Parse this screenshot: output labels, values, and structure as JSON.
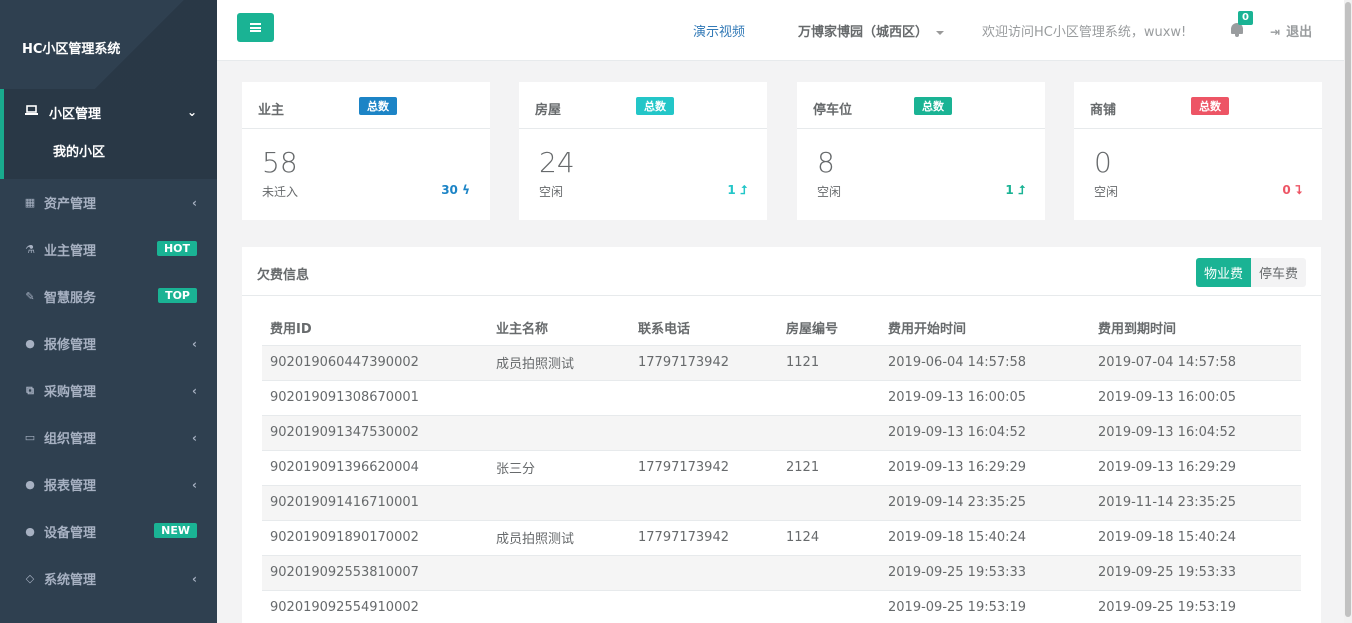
{
  "sidebar": {
    "brand": "HC小区管理系统",
    "active": {
      "label": "小区管理",
      "sub": "我的小区"
    },
    "items": [
      {
        "label": "资产管理",
        "icon": "grid-icon",
        "badge": ""
      },
      {
        "label": "业主管理",
        "icon": "flask-icon",
        "badge": "HOT"
      },
      {
        "label": "智慧服务",
        "icon": "edit-icon",
        "badge": "TOP"
      },
      {
        "label": "报修管理",
        "icon": "globe-icon",
        "badge": ""
      },
      {
        "label": "采购管理",
        "icon": "copy-icon",
        "badge": ""
      },
      {
        "label": "组织管理",
        "icon": "desktop-icon",
        "badge": ""
      },
      {
        "label": "报表管理",
        "icon": "globe-icon",
        "badge": ""
      },
      {
        "label": "设备管理",
        "icon": "globe-icon",
        "badge": "NEW"
      },
      {
        "label": "系统管理",
        "icon": "diamond-icon",
        "badge": ""
      }
    ]
  },
  "topbar": {
    "demo": "演示视频",
    "community": "万博家博园（城西区）",
    "welcome": "欢迎访问HC小区管理系统，wuxw!",
    "notifications": "0",
    "logout": "退出"
  },
  "cards": [
    {
      "title": "业主",
      "label": "总数",
      "label_color": "#1c84c6",
      "value": "58",
      "sub": "未迁入",
      "stat": "30",
      "stat_icon": "ϟ",
      "stat_color": "#1c84c6"
    },
    {
      "title": "房屋",
      "label": "总数",
      "label_color": "#23c6c8",
      "value": "24",
      "sub": "空闲",
      "stat": "1",
      "stat_icon": "⮥",
      "stat_color": "#23c6c8"
    },
    {
      "title": "停车位",
      "label": "总数",
      "label_color": "#1ab394",
      "value": "8",
      "sub": "空闲",
      "stat": "1",
      "stat_icon": "⮥",
      "stat_color": "#1ab394"
    },
    {
      "title": "商铺",
      "label": "总数",
      "label_color": "#ed5565",
      "value": "0",
      "sub": "空闲",
      "stat": "0",
      "stat_icon": "⮧",
      "stat_color": "#ed5565"
    }
  ],
  "fees": {
    "title": "欠费信息",
    "tab_active": "物业费",
    "tab_other": "停车费",
    "columns": [
      "费用ID",
      "业主名称",
      "联系电话",
      "房屋编号",
      "费用开始时间",
      "费用到期时间"
    ],
    "rows": [
      [
        "902019060447390002",
        "成员拍照测试",
        "17797173942",
        "1121",
        "2019-06-04 14:57:58",
        "2019-07-04 14:57:58"
      ],
      [
        "902019091308670001",
        "",
        "",
        "",
        "2019-09-13 16:00:05",
        "2019-09-13 16:00:05"
      ],
      [
        "902019091347530002",
        "",
        "",
        "",
        "2019-09-13 16:04:52",
        "2019-09-13 16:04:52"
      ],
      [
        "902019091396620004",
        "张三分",
        "17797173942",
        "2121",
        "2019-09-13 16:29:29",
        "2019-09-13 16:29:29"
      ],
      [
        "902019091416710001",
        "",
        "",
        "",
        "2019-09-14 23:35:25",
        "2019-11-14 23:35:25"
      ],
      [
        "902019091890170002",
        "成员拍照测试",
        "17797173942",
        "1124",
        "2019-09-18 15:40:24",
        "2019-09-18 15:40:24"
      ],
      [
        "902019092553810007",
        "",
        "",
        "",
        "2019-09-25 19:53:33",
        "2019-09-25 19:53:33"
      ],
      [
        "902019092554910002",
        "",
        "",
        "",
        "2019-09-25 19:53:19",
        "2019-09-25 19:53:19"
      ]
    ]
  }
}
